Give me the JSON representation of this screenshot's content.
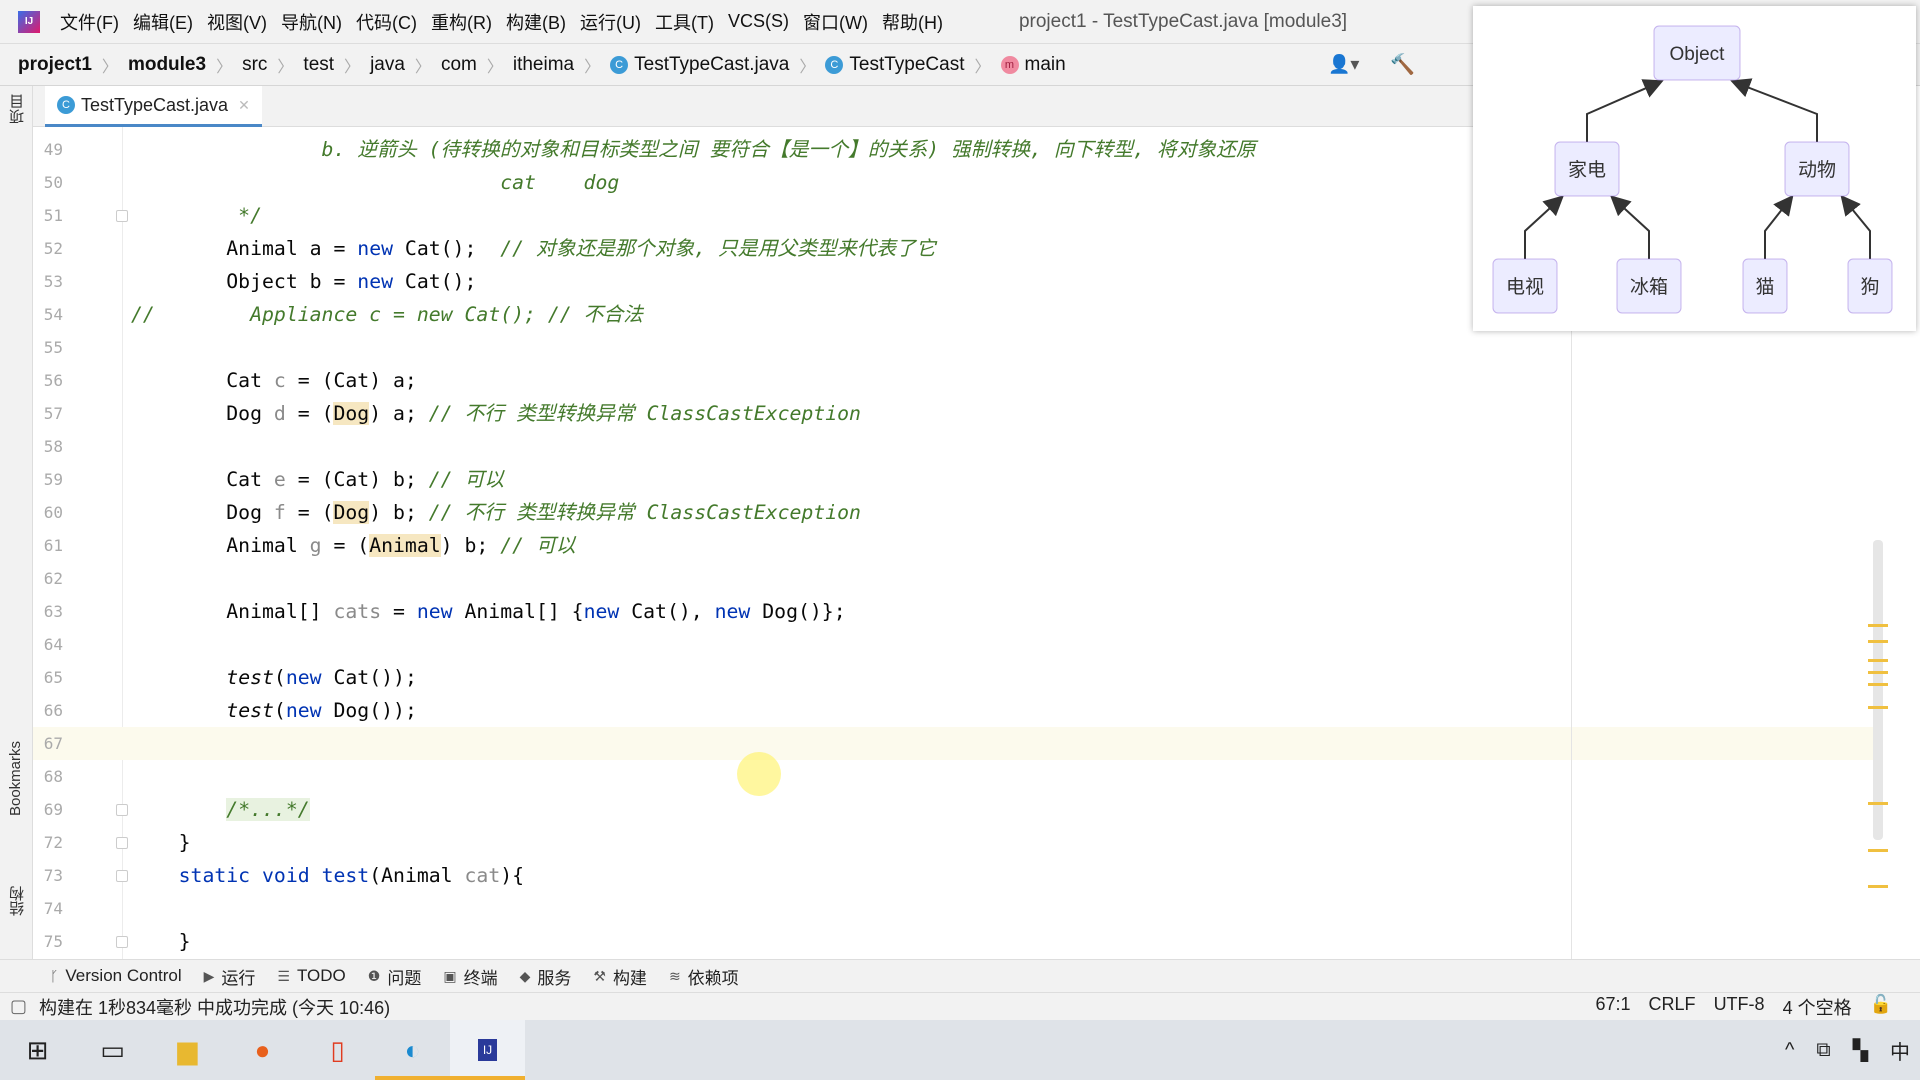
{
  "window_title": "project1 - TestTypeCast.java [module3]",
  "menu": [
    "文件(F)",
    "编辑(E)",
    "视图(V)",
    "导航(N)",
    "代码(C)",
    "重构(R)",
    "构建(B)",
    "运行(U)",
    "工具(T)",
    "VCS(S)",
    "窗口(W)",
    "帮助(H)"
  ],
  "breadcrumb": [
    {
      "label": "project1",
      "bold": true
    },
    {
      "label": "module3",
      "bold": true
    },
    {
      "label": "src"
    },
    {
      "label": "test"
    },
    {
      "label": "java"
    },
    {
      "label": "com"
    },
    {
      "label": "itheima"
    },
    {
      "label": "TestTypeCast.java",
      "icon": "class-icon"
    },
    {
      "label": "TestTypeCast",
      "icon": "class-icon"
    },
    {
      "label": "main",
      "icon": "method-icon"
    }
  ],
  "tab": {
    "label": "TestTypeCast.java"
  },
  "left_strip": {
    "project": "项目",
    "bookmarks": "Bookmarks",
    "structure": "结构"
  },
  "current_line": 67,
  "code": [
    {
      "n": "49",
      "tokens": [
        {
          "t": "                b. 逆箭头 (待转换的对象和目标类型之间 要符合【是一个】的关系) 强制转换, 向下转型, 将对象还原",
          "c": "cmt"
        }
      ]
    },
    {
      "n": "50",
      "tokens": [
        {
          "t": "                               cat    dog",
          "c": "cmt"
        }
      ]
    },
    {
      "n": "51",
      "fold": true,
      "tokens": [
        {
          "t": "         */",
          "c": "cmt"
        }
      ]
    },
    {
      "n": "52",
      "tokens": [
        {
          "t": "        Animal a = "
        },
        {
          "t": "new",
          "c": "kw"
        },
        {
          "t": " Cat();  "
        },
        {
          "t": "// 对象还是那个对象, 只是用父类型来代表了它",
          "c": "cmt"
        }
      ]
    },
    {
      "n": "53",
      "tokens": [
        {
          "t": "        Object b = "
        },
        {
          "t": "new",
          "c": "kw"
        },
        {
          "t": " Cat();"
        }
      ]
    },
    {
      "n": "54",
      "tokens": [
        {
          "t": "//        Appliance c = new Cat(); // 不合法",
          "c": "cmt"
        }
      ]
    },
    {
      "n": "55",
      "tokens": []
    },
    {
      "n": "56",
      "tokens": [
        {
          "t": "        Cat "
        },
        {
          "t": "c",
          "c": "var"
        },
        {
          "t": " = (Cat) a;"
        }
      ]
    },
    {
      "n": "57",
      "tokens": [
        {
          "t": "        Dog "
        },
        {
          "t": "d",
          "c": "var"
        },
        {
          "t": " = ("
        },
        {
          "t": "Dog",
          "c": "hl"
        },
        {
          "t": ") a; "
        },
        {
          "t": "// 不行 类型转换异常 ClassCastException",
          "c": "cmt"
        }
      ]
    },
    {
      "n": "58",
      "tokens": []
    },
    {
      "n": "59",
      "tokens": [
        {
          "t": "        Cat "
        },
        {
          "t": "e",
          "c": "var"
        },
        {
          "t": " = (Cat) b; "
        },
        {
          "t": "// 可以",
          "c": "cmt"
        }
      ]
    },
    {
      "n": "60",
      "tokens": [
        {
          "t": "        Dog "
        },
        {
          "t": "f",
          "c": "var"
        },
        {
          "t": " = ("
        },
        {
          "t": "Dog",
          "c": "hl"
        },
        {
          "t": ") b; "
        },
        {
          "t": "// 不行 类型转换异常 ClassCastException",
          "c": "cmt"
        }
      ]
    },
    {
      "n": "61",
      "tokens": [
        {
          "t": "        Animal "
        },
        {
          "t": "g",
          "c": "var"
        },
        {
          "t": " = ("
        },
        {
          "t": "Animal",
          "c": "hl"
        },
        {
          "t": ") b; "
        },
        {
          "t": "// 可以",
          "c": "cmt"
        }
      ]
    },
    {
      "n": "62",
      "tokens": []
    },
    {
      "n": "63",
      "tokens": [
        {
          "t": "        Animal[] "
        },
        {
          "t": "cats",
          "c": "var"
        },
        {
          "t": " = "
        },
        {
          "t": "new",
          "c": "kw"
        },
        {
          "t": " Animal[] {"
        },
        {
          "t": "new",
          "c": "kw"
        },
        {
          "t": " Cat(), "
        },
        {
          "t": "new",
          "c": "kw"
        },
        {
          "t": " Dog()};"
        }
      ]
    },
    {
      "n": "64",
      "tokens": []
    },
    {
      "n": "65",
      "tokens": [
        {
          "t": "        "
        },
        {
          "t": "test",
          "c": "mth"
        },
        {
          "t": "("
        },
        {
          "t": "new",
          "c": "kw"
        },
        {
          "t": " Cat());"
        }
      ]
    },
    {
      "n": "66",
      "tokens": [
        {
          "t": "        "
        },
        {
          "t": "test",
          "c": "mth"
        },
        {
          "t": "("
        },
        {
          "t": "new",
          "c": "kw"
        },
        {
          "t": " Dog());"
        }
      ]
    },
    {
      "n": "67",
      "tokens": []
    },
    {
      "n": "68",
      "tokens": []
    },
    {
      "n": "69",
      "fold": true,
      "tokens": [
        {
          "t": "        "
        },
        {
          "t": "/*...*/",
          "c": "cmt fbox"
        }
      ]
    },
    {
      "n": "72",
      "fold": true,
      "tokens": [
        {
          "t": "    }"
        }
      ]
    },
    {
      "n": "73",
      "fold": true,
      "tokens": [
        {
          "t": "    "
        },
        {
          "t": "static void",
          "c": "kw"
        },
        {
          "t": " "
        },
        {
          "t": "test",
          "c": "kw"
        },
        {
          "t": "(Animal "
        },
        {
          "t": "cat",
          "c": "var"
        },
        {
          "t": "){"
        }
      ]
    },
    {
      "n": "74",
      "tokens": []
    },
    {
      "n": "75",
      "fold": true,
      "tokens": [
        {
          "t": "    }"
        }
      ]
    }
  ],
  "diagram": {
    "nodes": {
      "object": "Object",
      "appliance": "家电",
      "animal": "动物",
      "tv": "电视",
      "fridge": "冰箱",
      "cat": "猫",
      "dog": "狗"
    },
    "node_fill": "#ececff",
    "node_stroke": "#9370db"
  },
  "tool_windows": [
    {
      "label": "Version Control",
      "icon": "git-branch-icon"
    },
    {
      "label": "运行",
      "icon": "play-icon"
    },
    {
      "label": "TODO",
      "icon": "list-icon"
    },
    {
      "label": "问题",
      "icon": "problem-icon"
    },
    {
      "label": "终端",
      "icon": "terminal-icon"
    },
    {
      "label": "服务",
      "icon": "services-icon"
    },
    {
      "label": "构建",
      "icon": "hammer-icon"
    },
    {
      "label": "依赖项",
      "icon": "layers-icon"
    }
  ],
  "status": {
    "message": "构建在 1秒834毫秒 中成功完成 (今天 10:46)",
    "position": "67:1",
    "line_sep": "CRLF",
    "encoding": "UTF-8",
    "indent": "4 个空格"
  },
  "taskbar": {
    "ime": "中"
  }
}
